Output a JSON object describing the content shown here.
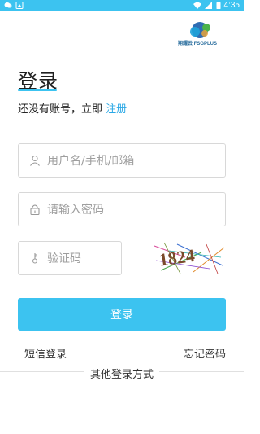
{
  "status_bar": {
    "time": "4:35",
    "left_icons": [
      "chat-bubble-icon",
      "notification-icon"
    ],
    "right_icons": [
      "wifi-icon",
      "cell-signal-icon",
      "battery-icon"
    ]
  },
  "brand": {
    "logo_text": "翔耀云 FSGPLUS",
    "colors": {
      "primary": "#3cc3f0",
      "link": "#2aa8e6"
    }
  },
  "page": {
    "title": "登录",
    "signup_prompt": "还没有账号，立即",
    "signup_link": "注册"
  },
  "form": {
    "username_placeholder": "用户名/手机/邮箱",
    "password_placeholder": "请输入密码",
    "captcha_placeholder": "验证码",
    "captcha_text": "1824",
    "submit_label": "登录"
  },
  "links": {
    "sms_login": "短信登录",
    "forgot_password": "忘记密码",
    "other_methods": "其他登录方式"
  }
}
